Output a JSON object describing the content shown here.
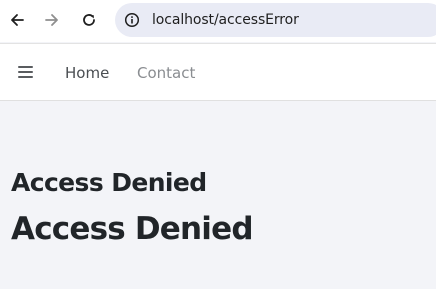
{
  "browser": {
    "url": "localhost/accessError",
    "icons": {
      "back": "arrow-left-icon",
      "forward": "arrow-right-icon",
      "reload": "reload-icon",
      "site_info": "info-icon"
    }
  },
  "navbar": {
    "menu_icon": "hamburger-icon",
    "links": [
      {
        "label": "Home"
      },
      {
        "label": "Contact"
      }
    ]
  },
  "main": {
    "heading_small": "Access Denied",
    "heading_large": "Access Denied"
  },
  "colors": {
    "page_background": "#f3f4f8",
    "omnibox_background": "#e9ebf5",
    "text": "#212529",
    "nav_link_muted": "#8a8d91"
  }
}
